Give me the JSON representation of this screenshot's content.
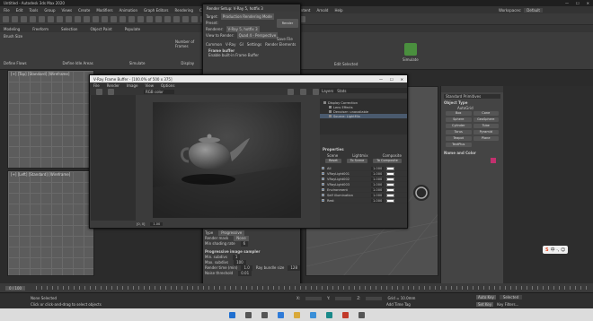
{
  "app": {
    "title": "Untitled - Autodesk 3ds Max 2020",
    "menus": [
      "File",
      "Edit",
      "Tools",
      "Group",
      "Views",
      "Create",
      "Modifiers",
      "Animation",
      "Graph Editors",
      "Rendering",
      "Civil View",
      "Customize",
      "Scripting",
      "Interactive",
      "Content",
      "Arnold",
      "Help"
    ],
    "workspace_label": "Workspaces:",
    "workspace_value": "Default",
    "search_placeholder": "C:\\Documents\\3ds Max 2020 ▾"
  },
  "ribbon": {
    "groups": [
      "Modeling",
      "Freeform",
      "Selection",
      "Object Paint",
      "Populate"
    ],
    "section_labels": [
      "Define Flows",
      "Define Idle Areas",
      "Simulate",
      "Display"
    ],
    "edit_selected_label": "Edit Selected",
    "brush_size_label": "Brush Size",
    "number_of_frames_label": "Number of Frames",
    "edit_selected_value": "Simulate"
  },
  "render_setup": {
    "title": "Render Setup: V-Ray 5, hotfix 3",
    "target_label": "Target:",
    "target_value": "Production Rendering Mode",
    "preset_label": "Preset:",
    "renderer_label": "Renderer:",
    "renderer_value": "V-Ray 5, hotfix 3",
    "view_label": "View to Render:",
    "view_value": "Quad 4 - Perspective",
    "render_button": "Render",
    "save_file": "Save File",
    "tabs": [
      "Common",
      "V-Ray",
      "GI",
      "Settings",
      "Render Elements"
    ],
    "frame_buffer": "Frame buffer",
    "enable_vfb": "Enable built-in Frame Buffer",
    "type_label": "Type",
    "type_value": "Progressive",
    "render_mask_label": "Render mask",
    "render_mask_value": "None",
    "min_shading_label": "Min shading rate",
    "min_shading_value": "6",
    "progressive_title": "Progressive image sampler",
    "min_subdivs_label": "Min. subdivs",
    "min_subdivs_value": "1",
    "max_subdivs_label": "Max. subdivs",
    "max_subdivs_value": "100",
    "render_time_label": "Render time (min)",
    "render_time_value": "1.0",
    "ray_bundle_label": "Ray bundle size",
    "ray_bundle_value": "128",
    "noise_label": "Noise threshold",
    "noise_value": "0.01"
  },
  "vfb": {
    "title": "V-Ray Frame Buffer - [100.0% of 500 x 375]",
    "menus": [
      "File",
      "Render",
      "Image",
      "View",
      "Options"
    ],
    "channel": "RGB color",
    "tabs": [
      "Layers",
      "Stats"
    ],
    "layers": [
      "Display Correction",
      "Lens Effects",
      "Denoiser: unavailable",
      "Source: LightMix"
    ],
    "properties_label": "Properties",
    "mode_tabs": [
      "Scene",
      "Lightmix",
      "Composite"
    ],
    "buttons": [
      "Reset",
      "To Scene",
      "To Composite"
    ],
    "light_rows": [
      {
        "name": "All",
        "value": "1.000"
      },
      {
        "name": "VRayLight001",
        "value": "1.000"
      },
      {
        "name": "VRayLight002",
        "value": "1.000"
      },
      {
        "name": "VRayLight003",
        "value": "1.000"
      },
      {
        "name": "Environment",
        "value": "1.000"
      },
      {
        "name": "Self illumination",
        "value": "1.000"
      },
      {
        "name": "Rest",
        "value": "1.000"
      }
    ],
    "footer_coords": "[0, 0]",
    "footer_value": "1.00"
  },
  "viewports": {
    "top": "[+] [Top] [Standard] [Wireframe]",
    "left": "[+] [Left] [Standard] [Wireframe]"
  },
  "cmd_panel": {
    "dropdown": "Standard Primitives",
    "object_type": "Object Type",
    "autogrid": "AutoGrid",
    "buttons": [
      "Box",
      "Cone",
      "Sphere",
      "GeoSphere",
      "Cylinder",
      "Tube",
      "Torus",
      "Pyramid",
      "Teapot",
      "Plane",
      "TextPlus"
    ],
    "name_color": "Name and Color"
  },
  "status": {
    "frame_counter": "0 / 100",
    "selected": "None Selected",
    "hint": "Click or click-and-drag to select objects",
    "autokey": "Auto Key",
    "selected_label": "Selected",
    "set_key": "Set Key",
    "key_filters": "Key Filters...",
    "add_time_tag": "Add Time Tag",
    "x_label": "X:",
    "y_label": "Y:",
    "z_label": "Z:",
    "grid": "Grid = 10.0mm"
  },
  "ime": {
    "label": "中 ·, ☺"
  }
}
